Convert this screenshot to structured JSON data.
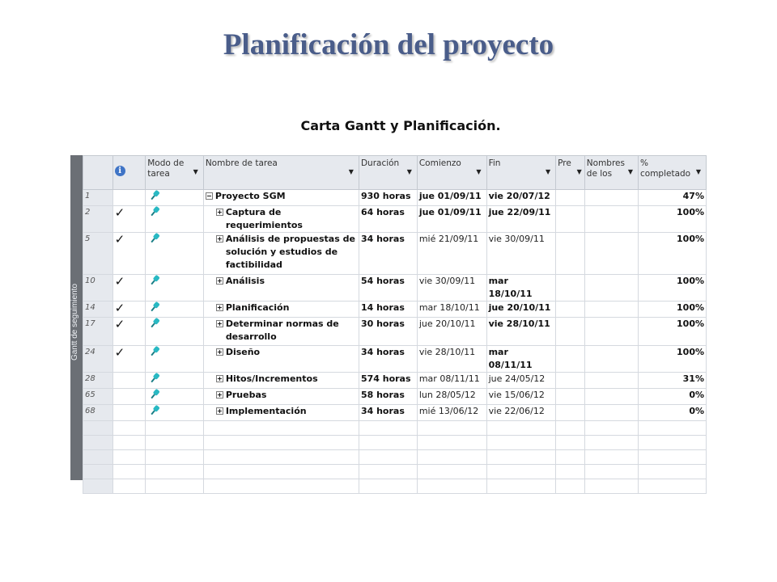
{
  "title": "Planificación del proyecto",
  "subtitle": "Carta Gantt y Planificación.",
  "sidebar_label": "Gantt de seguimiento",
  "headers": {
    "mode": "Modo de tarea",
    "name": "Nombre de tarea",
    "duration": "Duración",
    "start": "Comienzo",
    "end": "Fin",
    "pred": "Pre",
    "resources": "Nombres de los",
    "pct": "% completado"
  },
  "rows": [
    {
      "id": "1",
      "check": "",
      "name": "Proyecto SGM",
      "expander": "−",
      "indent": 0,
      "duration": "930 horas",
      "start": "jue 01/09/11",
      "end": "vie 20/07/12",
      "pct": "47%",
      "bold": [
        1,
        1,
        1,
        1,
        1
      ]
    },
    {
      "id": "2",
      "check": "✓",
      "name": "Captura de requerimientos",
      "expander": "+",
      "indent": 1,
      "duration": "64 horas",
      "start": "jue 01/09/11",
      "end": "jue 22/09/11",
      "pct": "100%",
      "bold": [
        1,
        1,
        1,
        1,
        1
      ]
    },
    {
      "id": "5",
      "check": "✓",
      "name": "Análisis de propuestas de solución y estudios de factibilidad",
      "expander": "+",
      "indent": 1,
      "duration": "34 horas",
      "start": "mié 21/09/11",
      "end": "vie 30/09/11",
      "pct": "100%",
      "bold": [
        1,
        1,
        0,
        0,
        1
      ]
    },
    {
      "id": "10",
      "check": "✓",
      "name": "Análisis",
      "expander": "+",
      "indent": 1,
      "duration": "54 horas",
      "start": "vie 30/09/11",
      "end": "mar 18/10/11",
      "pct": "100%",
      "bold": [
        1,
        1,
        0,
        1,
        1
      ]
    },
    {
      "id": "14",
      "check": "✓",
      "name": "Planificación",
      "expander": "+",
      "indent": 1,
      "duration": "14 horas",
      "start": "mar 18/10/11",
      "end": "jue 20/10/11",
      "pct": "100%",
      "bold": [
        1,
        1,
        0,
        1,
        1
      ]
    },
    {
      "id": "17",
      "check": "✓",
      "name": "Determinar normas de desarrollo",
      "expander": "+",
      "indent": 1,
      "duration": "30 horas",
      "start": "jue 20/10/11",
      "end": "vie 28/10/11",
      "pct": "100%",
      "bold": [
        1,
        1,
        0,
        1,
        1
      ]
    },
    {
      "id": "24",
      "check": "✓",
      "name": "Diseño",
      "expander": "+",
      "indent": 1,
      "duration": "34 horas",
      "start": "vie 28/10/11",
      "end": "mar 08/11/11",
      "pct": "100%",
      "bold": [
        1,
        1,
        0,
        1,
        1
      ]
    },
    {
      "id": "28",
      "check": "",
      "name": "Hitos/Incrementos",
      "expander": "+",
      "indent": 1,
      "duration": "574 horas",
      "start": "mar 08/11/11",
      "end": "jue 24/05/12",
      "pct": "31%",
      "bold": [
        1,
        1,
        0,
        0,
        1
      ]
    },
    {
      "id": "65",
      "check": "",
      "name": "Pruebas",
      "expander": "+",
      "indent": 1,
      "duration": "58 horas",
      "start": "lun 28/05/12",
      "end": "vie 15/06/12",
      "pct": "0%",
      "bold": [
        1,
        1,
        0,
        0,
        1
      ]
    },
    {
      "id": "68",
      "check": "",
      "name": "Implementación",
      "expander": "+",
      "indent": 1,
      "duration": "34 horas",
      "start": "mié 13/06/12",
      "end": "vie 22/06/12",
      "pct": "0%",
      "bold": [
        1,
        1,
        0,
        0,
        1
      ]
    }
  ],
  "colors": {
    "title": "#4a5d8a",
    "sidebar": "#6b6f75",
    "header_bg": "#e6e9ee",
    "pin": "#29b9c3",
    "info_icon": "#3f74c6",
    "header_accent": "#f0a830"
  },
  "icons": {
    "info": "info-icon",
    "mode": "pin-icon",
    "check": "check-icon"
  }
}
